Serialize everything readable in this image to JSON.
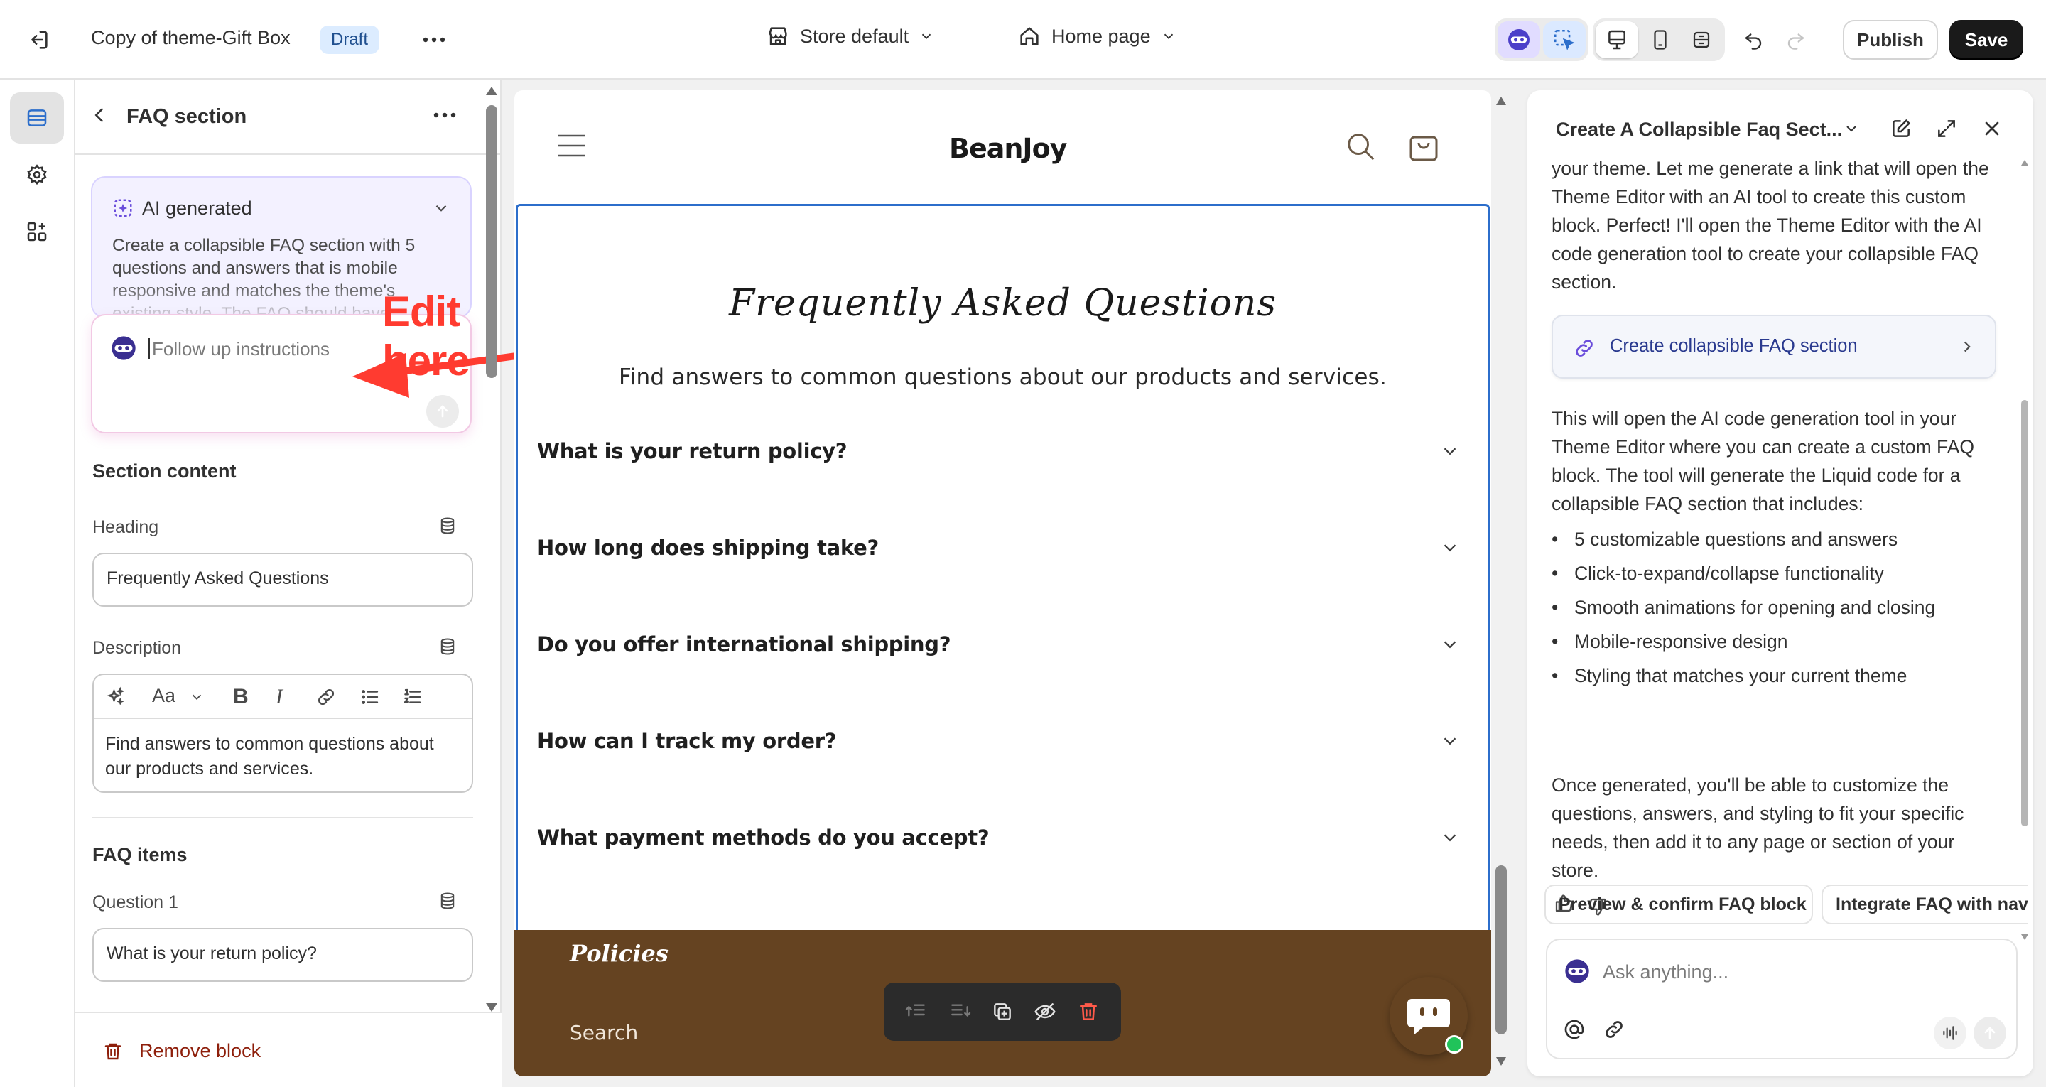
{
  "topbar": {
    "doc_title": "Copy of theme-Gift Box",
    "status_badge": "Draft",
    "store_selector": "Store default",
    "page_selector": "Home page",
    "publish_label": "Publish",
    "save_label": "Save"
  },
  "left_panel": {
    "title": "FAQ section",
    "ai_card": {
      "title": "AI generated",
      "description": "Create a collapsible FAQ section with 5 questions and answers that is mobile responsive and matches the theme's existing style. The FAQ should have"
    },
    "followup": {
      "placeholder": "Follow up instructions"
    },
    "annotation": "Edit here",
    "section_content_heading": "Section content",
    "heading_label": "Heading",
    "heading_value": "Frequently Asked Questions",
    "description_label": "Description",
    "description_value": "Find answers to common questions about our products and services.",
    "rte_font_label": "Aa",
    "faq_items_heading": "FAQ items",
    "question1_label": "Question 1",
    "question1_value": "What is your return policy?",
    "remove_block_label": "Remove block"
  },
  "preview": {
    "logo_text": "BeanJoy",
    "faq_title": "Frequently Asked Questions",
    "faq_subtitle": "Find answers to common questions about our products and services.",
    "questions": [
      "What is your return policy?",
      "How long does shipping take?",
      "Do you offer international shipping?",
      "How can I track my order?",
      "What payment methods do you accept?"
    ],
    "footer_heading": "Policies",
    "footer_link": "Search"
  },
  "right_panel": {
    "title": "Create A Collapsible Faq Sect...",
    "para1": "your theme. Let me generate a link that will open the Theme Editor with an AI tool to create this custom block. Perfect! I'll open the Theme Editor with the AI code generation tool to create your collapsible FAQ section.",
    "link_card": "Create collapsible FAQ section",
    "para2": "This will open the AI code generation tool in your Theme Editor where you can create a custom FAQ block. The tool will generate the Liquid code for a collapsible FAQ section that includes:",
    "bullets": [
      "5 customizable questions and answers",
      "Click-to-expand/collapse functionality",
      "Smooth animations for opening and closing",
      "Mobile-responsive design",
      "Styling that matches your current theme"
    ],
    "para3": "Once generated, you'll be able to customize the questions, answers, and styling to fit your specific needs, then add it to any page or section of your store.",
    "chips": [
      "Preview & confirm FAQ block",
      "Integrate FAQ with nav"
    ],
    "ask_placeholder": "Ask anything..."
  },
  "colors": {
    "accent_blue": "#2c6ecb",
    "footer_brown": "#654321",
    "critical_red": "#8e1f0b",
    "annotation_red": "#ff3b30"
  }
}
